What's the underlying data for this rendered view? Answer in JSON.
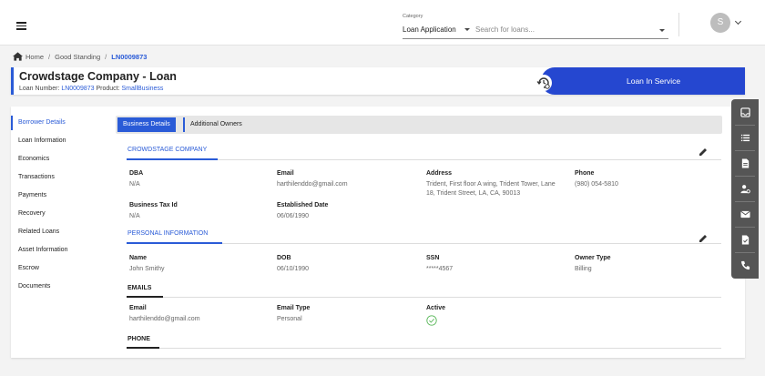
{
  "topbar": {
    "category_label": "Category",
    "category_value": "Loan Application",
    "search_placeholder": "Search for loans...",
    "avatar_initial": "S"
  },
  "breadcrumb": {
    "home": "Home",
    "middle": "Good Standing",
    "current": "LN0009873"
  },
  "loan": {
    "title": "Crowdstage Company - Loan",
    "number_label": "Loan Number:",
    "number": "LN0009873",
    "product_label": "Product:",
    "product": "SmallBusiness",
    "status": "Loan In Service"
  },
  "sidebar": {
    "items": [
      {
        "label": "Borrower Details"
      },
      {
        "label": "Loan Information"
      },
      {
        "label": "Economics"
      },
      {
        "label": "Transactions"
      },
      {
        "label": "Payments"
      },
      {
        "label": "Recovery"
      },
      {
        "label": "Related Loans"
      },
      {
        "label": "Asset Information"
      },
      {
        "label": "Escrow"
      },
      {
        "label": "Documents"
      }
    ]
  },
  "tabs": [
    {
      "label": "Business Details"
    },
    {
      "label": "Additional Owners"
    }
  ],
  "business": {
    "title": "CROWDSTAGE COMPANY",
    "dba_label": "DBA",
    "dba": "N/A",
    "email_label": "Email",
    "email": "harthilenddo@gmail.com",
    "address_label": "Address",
    "address_line1": "Trident, First floor A wing, Trident Tower, Lane",
    "address_line2": "18, Trident Street, LA, CA, 90013",
    "phone_label": "Phone",
    "phone": "(980) 054-5810",
    "tax_label": "Business Tax Id",
    "tax": "N/A",
    "established_label": "Established Date",
    "established": "06/06/1990"
  },
  "personal": {
    "title": "PERSONAL INFORMATION",
    "name_label": "Name",
    "name": "John Smithy",
    "dob_label": "DOB",
    "dob": "06/10/1990",
    "ssn_label": "SSN",
    "ssn": "*****4567",
    "owner_type_label": "Owner Type",
    "owner_type": "Billing"
  },
  "emails": {
    "title": "EMAILS",
    "email_label": "Email",
    "email": "harthilenddo@gmail.com",
    "type_label": "Email Type",
    "type": "Personal",
    "active_label": "Active"
  },
  "phone_section": {
    "title": "PHONE"
  },
  "toolbar_icons": [
    "inbox-icon",
    "list-icon",
    "document-icon",
    "user-settings-icon",
    "mail-icon",
    "file-check-icon",
    "phone-icon"
  ]
}
